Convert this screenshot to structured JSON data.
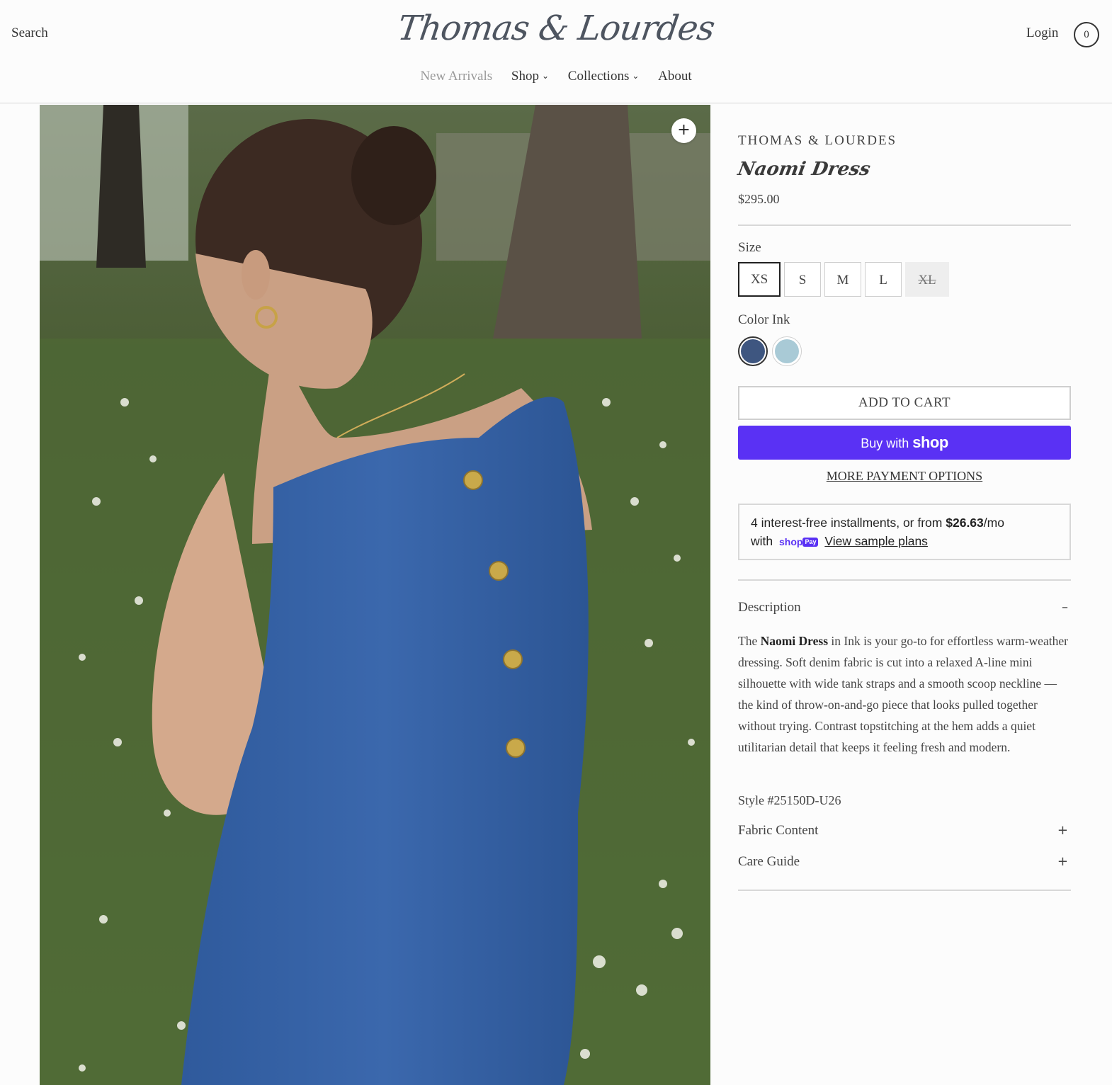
{
  "header": {
    "search_label": "Search",
    "logo_text": "Thomas & Lourdes",
    "login_label": "Login",
    "cart_count": "0",
    "nav": [
      {
        "label": "New Arrivals",
        "has_dropdown": false
      },
      {
        "label": "Shop",
        "has_dropdown": true
      },
      {
        "label": "Collections",
        "has_dropdown": true
      },
      {
        "label": "About",
        "has_dropdown": false
      }
    ]
  },
  "gallery": {
    "zoom_icon": "plus-icon",
    "zoom_symbol": "+"
  },
  "product": {
    "brand": "THOMAS & LOURDES",
    "title": "Naomi Dress",
    "price": "$295.00",
    "size_label": "Size",
    "sizes": [
      {
        "label": "XS",
        "state": "selected"
      },
      {
        "label": "S",
        "state": "available"
      },
      {
        "label": "M",
        "state": "available"
      },
      {
        "label": "L",
        "state": "available"
      },
      {
        "label": "XL",
        "state": "sold-out"
      }
    ],
    "color_label": "Color",
    "color_value": "Ink",
    "colors": [
      {
        "name": "Ink",
        "hex": "#3e5680",
        "selected": true
      },
      {
        "name": "Light Blue",
        "hex": "#a9cad6",
        "selected": false
      }
    ],
    "add_to_cart": "ADD TO CART",
    "buy_with": "Buy with",
    "buy_brand": "shop",
    "more_payment": "MORE PAYMENT OPTIONS",
    "installments": {
      "text_before": "4 interest-free installments, or from",
      "amount": "$26.63",
      "per": "/mo",
      "with": "with",
      "shoppay_text": "shop",
      "pay_text": "Pay",
      "link": "View sample plans"
    },
    "description": {
      "title": "Description",
      "icon": "minus-icon",
      "symbol": "–",
      "intro": "The",
      "bold": "Naomi Dress",
      "body": "in Ink is your go-to for effortless warm-weather dressing. Soft denim fabric is cut into a relaxed A-line mini silhouette with wide tank straps and a smooth scoop neckline — the kind of throw-on-and-go piece that looks pulled together without trying. Contrast topstitching at the hem adds a quiet utilitarian detail that keeps it feeling fresh and modern.",
      "style_number": "Style #25150D-U26"
    },
    "accordions": [
      {
        "title": "Fabric Content",
        "icon": "plus-icon",
        "symbol": "+"
      },
      {
        "title": "Care Guide",
        "icon": "plus-icon",
        "symbol": "+"
      }
    ]
  }
}
